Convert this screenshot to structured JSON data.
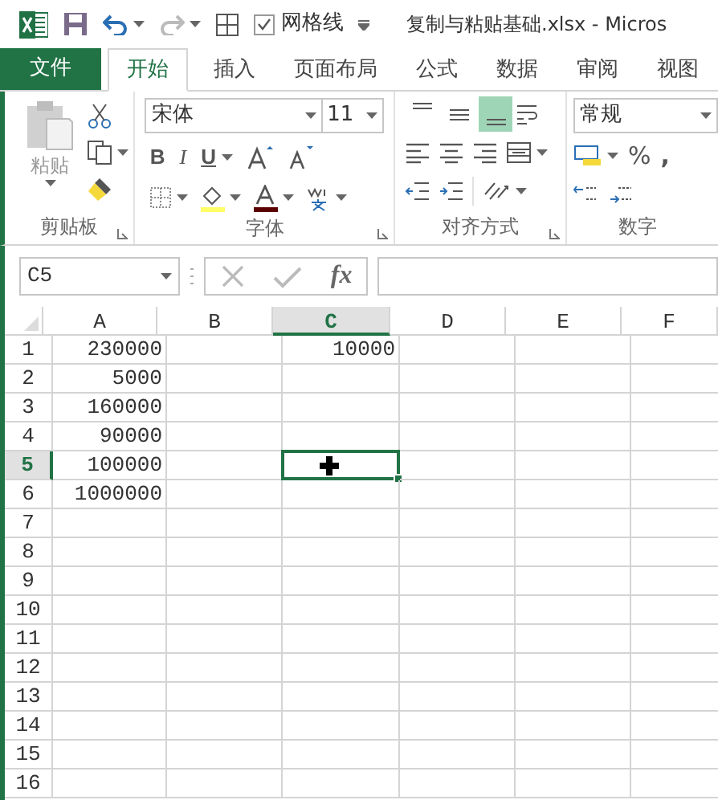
{
  "title_bar": {
    "gridlines": {
      "label": "网格线",
      "checked": true
    },
    "title": "复制与粘贴基础.xlsx - Micros"
  },
  "tabs": [
    {
      "label": "文件",
      "kind": "file",
      "selected": false
    },
    {
      "label": "开始",
      "kind": "tab",
      "selected": true
    },
    {
      "label": "插入",
      "kind": "tab",
      "selected": false
    },
    {
      "label": "页面布局",
      "kind": "tab",
      "selected": false
    },
    {
      "label": "公式",
      "kind": "tab",
      "selected": false
    },
    {
      "label": "数据",
      "kind": "tab",
      "selected": false
    },
    {
      "label": "审阅",
      "kind": "tab",
      "selected": false
    },
    {
      "label": "视图",
      "kind": "tab",
      "selected": false
    }
  ],
  "ribbon": {
    "clipboard": {
      "paste_label": "粘贴",
      "group_label": "剪贴板"
    },
    "font": {
      "font_name": "宋体",
      "font_size": "11",
      "bold": "B",
      "italic": "I",
      "underline": "U",
      "group_label": "字体"
    },
    "alignment": {
      "vertical": [
        {
          "kind": "top",
          "selected": false
        },
        {
          "kind": "middle",
          "selected": false
        },
        {
          "kind": "bottom",
          "selected": true
        }
      ],
      "group_label": "对齐方式"
    },
    "number": {
      "format": "常规",
      "percent": "%",
      "comma": ",",
      "group_label": "数字"
    }
  },
  "formula_bar": {
    "name_box": "C5",
    "fx": "fx"
  },
  "columns": [
    {
      "label": "A",
      "selected": false
    },
    {
      "label": "B",
      "selected": false
    },
    {
      "label": "C",
      "selected": true
    },
    {
      "label": "D",
      "selected": false
    },
    {
      "label": "E",
      "selected": false
    },
    {
      "label": "F",
      "selected": false
    }
  ],
  "rows": [
    {
      "label": "1",
      "selected": false,
      "cells": [
        "230000",
        "",
        "10000",
        "",
        "",
        ""
      ]
    },
    {
      "label": "2",
      "selected": false,
      "cells": [
        "5000",
        "",
        "",
        "",
        "",
        ""
      ]
    },
    {
      "label": "3",
      "selected": false,
      "cells": [
        "160000",
        "",
        "",
        "",
        "",
        ""
      ]
    },
    {
      "label": "4",
      "selected": false,
      "cells": [
        "90000",
        "",
        "",
        "",
        "",
        ""
      ]
    },
    {
      "label": "5",
      "selected": true,
      "cells": [
        "100000",
        "",
        "",
        "",
        "",
        ""
      ]
    },
    {
      "label": "6",
      "selected": false,
      "cells": [
        "1000000",
        "",
        "",
        "",
        "",
        ""
      ]
    },
    {
      "label": "7",
      "selected": false,
      "cells": [
        "",
        "",
        "",
        "",
        "",
        ""
      ]
    },
    {
      "label": "8",
      "selected": false,
      "cells": [
        "",
        "",
        "",
        "",
        "",
        ""
      ]
    },
    {
      "label": "9",
      "selected": false,
      "cells": [
        "",
        "",
        "",
        "",
        "",
        ""
      ]
    },
    {
      "label": "10",
      "selected": false,
      "cells": [
        "",
        "",
        "",
        "",
        "",
        ""
      ]
    },
    {
      "label": "11",
      "selected": false,
      "cells": [
        "",
        "",
        "",
        "",
        "",
        ""
      ]
    },
    {
      "label": "12",
      "selected": false,
      "cells": [
        "",
        "",
        "",
        "",
        "",
        ""
      ]
    },
    {
      "label": "13",
      "selected": false,
      "cells": [
        "",
        "",
        "",
        "",
        "",
        ""
      ]
    },
    {
      "label": "14",
      "selected": false,
      "cells": [
        "",
        "",
        "",
        "",
        "",
        ""
      ]
    },
    {
      "label": "15",
      "selected": false,
      "cells": [
        "",
        "",
        "",
        "",
        "",
        ""
      ]
    },
    {
      "label": "16",
      "selected": false,
      "cells": [
        "",
        "",
        "",
        "",
        "",
        ""
      ]
    }
  ]
}
